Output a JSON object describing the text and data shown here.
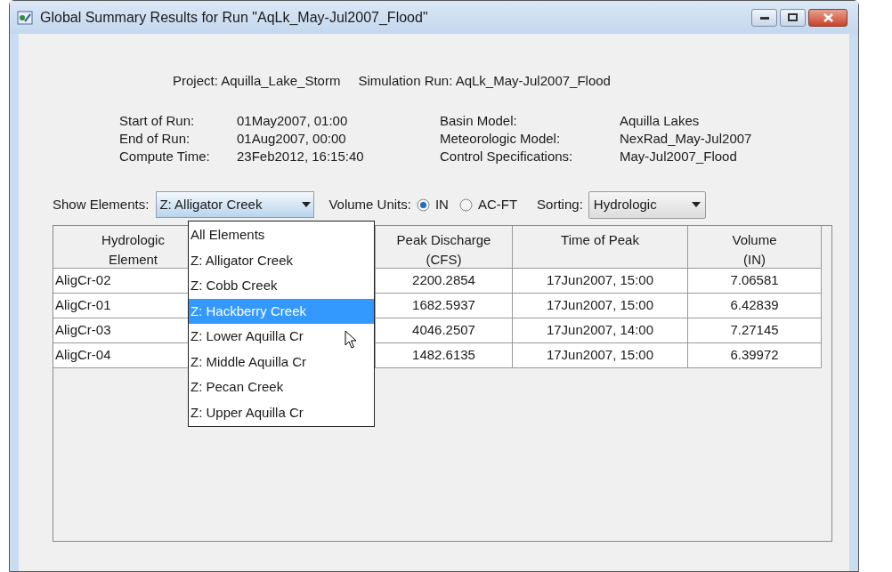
{
  "window": {
    "title": "Global Summary Results for Run \"AqLk_May-Jul2007_Flood\""
  },
  "header": [
    {
      "label": "Project:",
      "value": "Aquilla_Lake_Storm"
    },
    {
      "label": "Simulation Run:",
      "value": "AqLk_May-Jul2007_Flood"
    }
  ],
  "run_info_left": [
    {
      "label": "Start of Run:",
      "value": "01May2007, 01:00"
    },
    {
      "label": "End of Run:",
      "value": "01Aug2007, 00:00"
    },
    {
      "label": "Compute Time:",
      "value": "23Feb2012, 16:15:40"
    }
  ],
  "run_info_right": [
    {
      "label": "Basin Model:",
      "value": "Aquilla Lakes"
    },
    {
      "label": "Meteorologic Model:",
      "value": "NexRad_May-Jul2007"
    },
    {
      "label": "Control Specifications:",
      "value": "May-Jul2007_Flood"
    }
  ],
  "show_elements": {
    "label": "Show Elements:",
    "value": "Z: Alligator Creek",
    "expanded": true,
    "options": [
      {
        "label": "All Elements",
        "highlighted": false
      },
      {
        "label": "Z: Alligator Creek",
        "highlighted": false
      },
      {
        "label": "Z: Cobb Creek",
        "highlighted": false
      },
      {
        "label": "Z: Hackberry Creek",
        "highlighted": true
      },
      {
        "label": "Z: Lower Aquilla Cr",
        "highlighted": false
      },
      {
        "label": "Z: Middle Aquilla Cr",
        "highlighted": false
      },
      {
        "label": "Z: Pecan Creek",
        "highlighted": false
      },
      {
        "label": "Z: Upper Aquilla Cr",
        "highlighted": false
      }
    ]
  },
  "volume_units": {
    "label": "Volume Units:",
    "options": [
      {
        "label": "IN",
        "selected": true
      },
      {
        "label": "AC-FT",
        "selected": false
      }
    ]
  },
  "sorting": {
    "label": "Sorting:",
    "value": "Hydrologic"
  },
  "table": {
    "columns": [
      "Hydrologic Element",
      "Peak Discharge (CFS)",
      "Time of Peak",
      "Volume (IN)"
    ],
    "rows": [
      [
        "AligCr-02",
        "2200.2854",
        "17Jun2007, 15:00",
        "7.06581"
      ],
      [
        "AligCr-01",
        "1682.5937",
        "17Jun2007, 15:00",
        "6.42839"
      ],
      [
        "AligCr-03",
        "4046.2507",
        "17Jun2007, 14:00",
        "7.27145"
      ],
      [
        "AligCr-04",
        "1482.6135",
        "17Jun2007, 15:00",
        "6.39972"
      ]
    ]
  }
}
